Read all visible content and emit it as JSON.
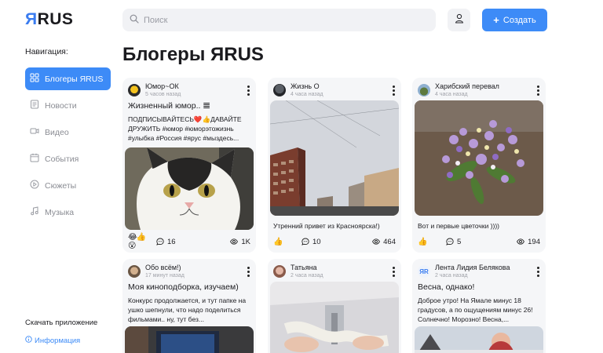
{
  "header": {
    "logo_ya": "Я",
    "logo_rus": "RUS",
    "search_placeholder": "Поиск",
    "create_label": "Создать"
  },
  "sidebar": {
    "title": "Навигация:",
    "items": [
      {
        "label": "Блогеры ЯRUS",
        "icon": "grid-icon",
        "active": true
      },
      {
        "label": "Новости",
        "icon": "news-icon"
      },
      {
        "label": "Видео",
        "icon": "video-icon"
      },
      {
        "label": "События",
        "icon": "calendar-icon"
      },
      {
        "label": "Сюжеты",
        "icon": "play-icon"
      },
      {
        "label": "Музыка",
        "icon": "music-icon"
      }
    ],
    "download": "Скачать приложение",
    "info": "Информация"
  },
  "main": {
    "title": "Блогеры ЯRUS",
    "posts": [
      {
        "author": "Юмор~ОК",
        "time": "5 часов назад",
        "title": "Жизненный юмор.. 𝌆",
        "text": "ПОДПИСЫВАЙТЕСЬ❤️👍ДАВАЙТЕ ДРУЖИТЬ #юмор #юморэтожизнь #улыбка #Россия #ярус #мыздесь...",
        "reactions": "😂👍😮",
        "comments": "16",
        "views": "1K"
      },
      {
        "author": "Жизнь О",
        "time": "4 часа назад",
        "caption": "Утренний привет из Красноярска!)",
        "reactions": "👍",
        "comments": "10",
        "views": "464"
      },
      {
        "author": "Харибский перевал",
        "time": "4 часа назад",
        "caption": "Вот и первые цветочки ))))",
        "reactions": "👍",
        "comments": "5",
        "views": "194"
      },
      {
        "author": "Обо всём!)",
        "time": "17 минут назад",
        "title": "Моя киноподборка, изучаем)",
        "text": "Конкурс продолжается, и тут папке на ушко шепнули, что надо поделиться фильмами.. ну, тут без..."
      },
      {
        "author": "Татьяна",
        "time": "2 часа назад"
      },
      {
        "author": "Лента Лидия Белякова",
        "time": "2 часа назад",
        "title": "Весна, однако!",
        "text": "Доброе утро! На Ямале минус 18 градусов, а по ощущениям минус 26! Солнечно! Морозно! Весна,..."
      }
    ]
  }
}
